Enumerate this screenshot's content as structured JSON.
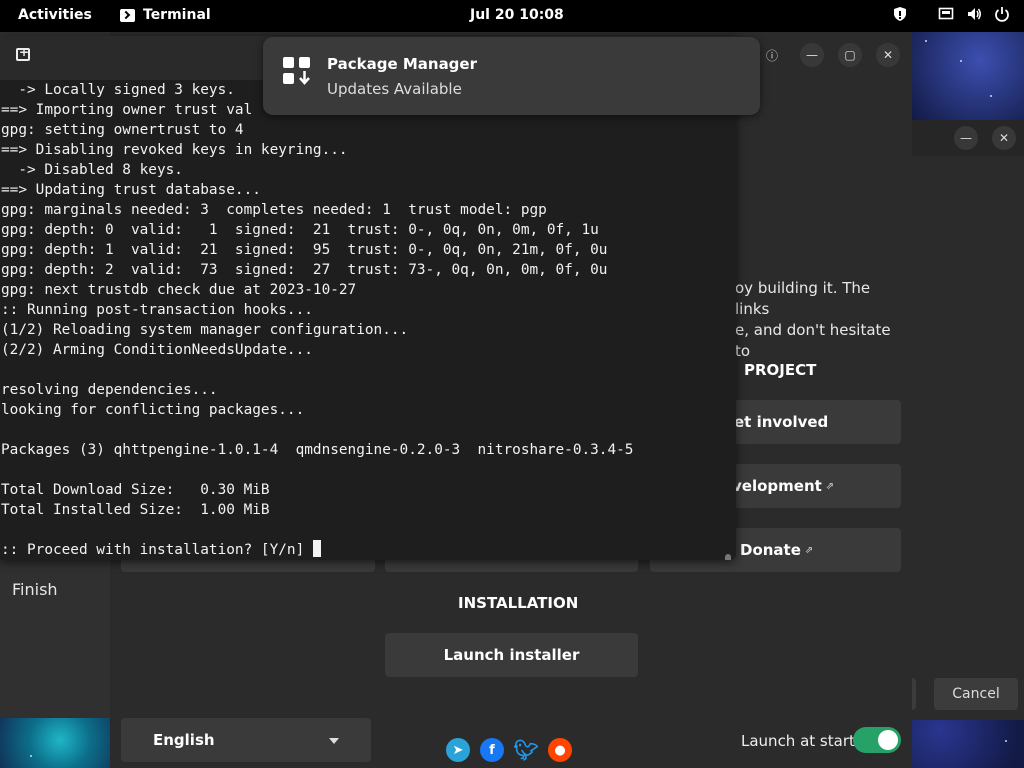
{
  "topbar": {
    "activities": "Activities",
    "app_name": "Terminal",
    "clock": "Jul 20  10:08"
  },
  "notification": {
    "title": "Package Manager",
    "body": "Updates Available"
  },
  "terminal": {
    "lines": [
      "  -> Locally signed 3 keys.",
      "==> Importing owner trust val",
      "gpg: setting ownertrust to 4",
      "==> Disabling revoked keys in keyring...",
      "  -> Disabled 8 keys.",
      "==> Updating trust database...",
      "gpg: marginals needed: 3  completes needed: 1  trust model: pgp",
      "gpg: depth: 0  valid:   1  signed:  21  trust: 0-, 0q, 0n, 0m, 0f, 1u",
      "gpg: depth: 1  valid:  21  signed:  95  trust: 0-, 0q, 0n, 21m, 0f, 0u",
      "gpg: depth: 2  valid:  73  signed:  27  trust: 73-, 0q, 0n, 0m, 0f, 0u",
      "gpg: next trustdb check due at 2023-10-27",
      ":: Running post-transaction hooks...",
      "(1/2) Reloading system manager configuration...",
      "(2/2) Arming ConditionNeedsUpdate...",
      "",
      "resolving dependencies...",
      "looking for conflicting packages...",
      "",
      "Packages (3) qhttpengine-1.0.1-4  qmdnsengine-0.2.0-3  nitroshare-0.3.4-5",
      "",
      "Total Download Size:   0.30 MiB",
      "Total Installed Size:  1.00 MiB",
      ""
    ],
    "prompt": ":: Proceed with installation? [Y/n] "
  },
  "welcome": {
    "body_line1": "oy building it. The links",
    "body_line2": "e, and don't hesitate to",
    "project_title": "PROJECT",
    "get_involved": "et involved",
    "development": "velopment",
    "donate": "Donate",
    "installation_title": "INSTALLATION",
    "launch_installer": "Launch installer",
    "finish": "Finish",
    "language": "English",
    "launch_at_start": "Launch at start",
    "launch_at_start_enabled": true
  },
  "second_window": {
    "cancel": "Cancel"
  },
  "colors": {
    "toggle_on": "#26a269",
    "telegram": "#2aa3d8",
    "facebook": "#1877f2",
    "twitter": "#1d9bf0",
    "reddit": "#ff4500"
  }
}
